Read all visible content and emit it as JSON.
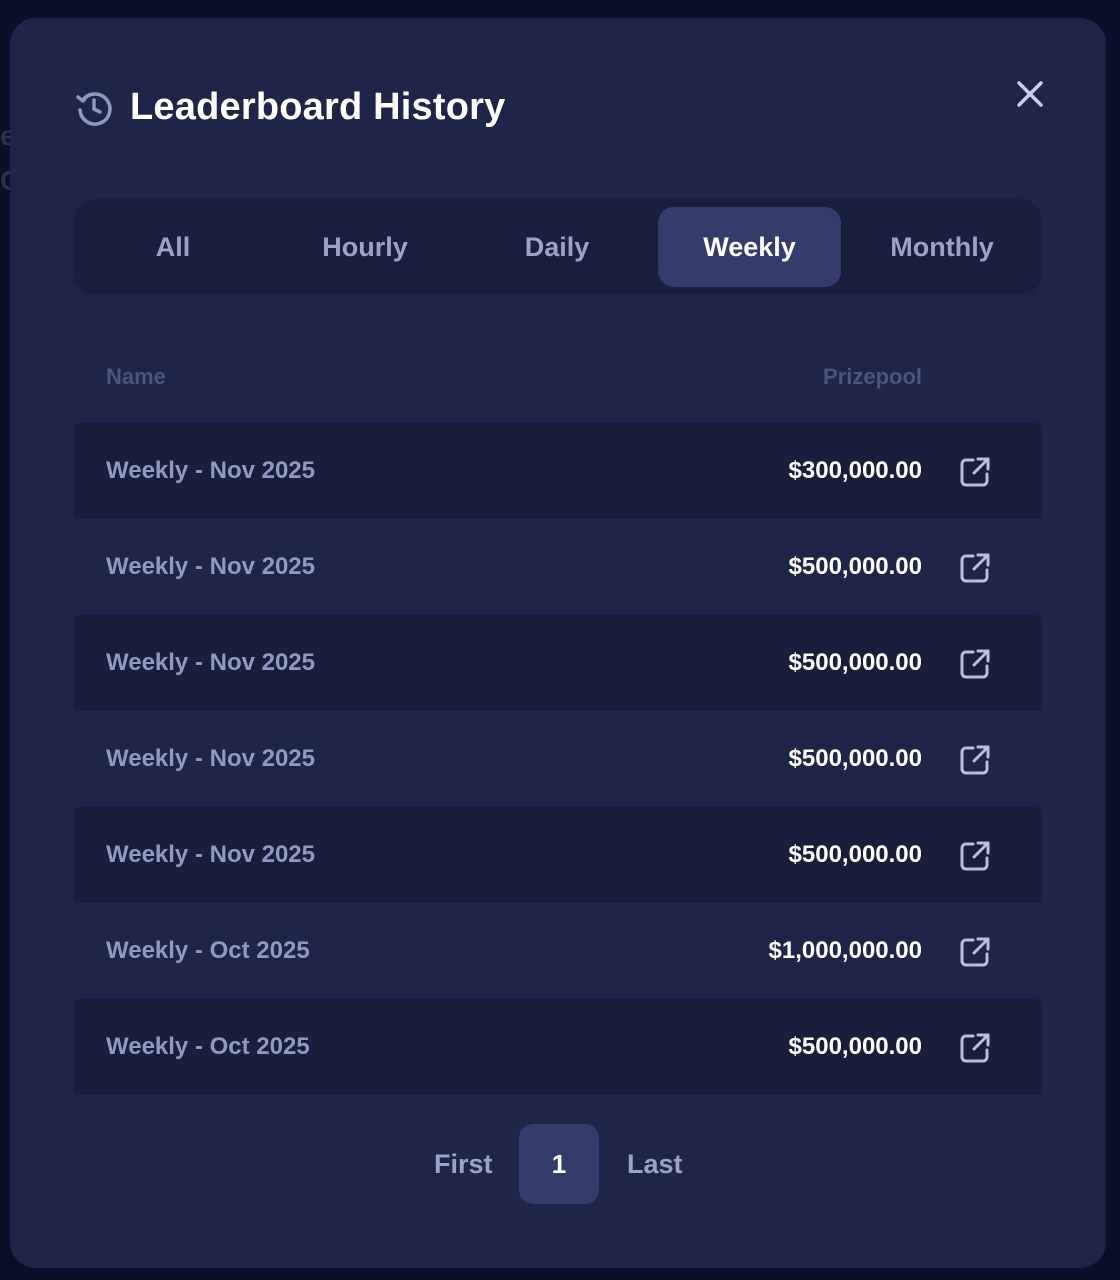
{
  "modal": {
    "title": "Leaderboard History",
    "title_icon": "history-clock-icon",
    "close_icon": "close-icon"
  },
  "tabs": [
    {
      "label": "All",
      "active": false
    },
    {
      "label": "Hourly",
      "active": false
    },
    {
      "label": "Daily",
      "active": false
    },
    {
      "label": "Weekly",
      "active": true
    },
    {
      "label": "Monthly",
      "active": false
    }
  ],
  "table": {
    "headers": {
      "name": "Name",
      "prizepool": "Prizepool"
    },
    "rows": [
      {
        "name": "Weekly - Nov 2025",
        "prizepool": "$300,000.00"
      },
      {
        "name": "Weekly - Nov 2025",
        "prizepool": "$500,000.00"
      },
      {
        "name": "Weekly - Nov 2025",
        "prizepool": "$500,000.00"
      },
      {
        "name": "Weekly - Nov 2025",
        "prizepool": "$500,000.00"
      },
      {
        "name": "Weekly - Nov 2025",
        "prizepool": "$500,000.00"
      },
      {
        "name": "Weekly - Oct 2025",
        "prizepool": "$1,000,000.00"
      },
      {
        "name": "Weekly - Oct 2025",
        "prizepool": "$500,000.00"
      }
    ],
    "row_link_icon": "external-link-icon"
  },
  "pagination": {
    "first": "First",
    "current": "1",
    "last": "Last"
  },
  "colors": {
    "modal_bg": "#1e2546",
    "active_tab": "#333c6a",
    "text_muted": "#8e98c2",
    "text_primary": "#ffffff"
  }
}
